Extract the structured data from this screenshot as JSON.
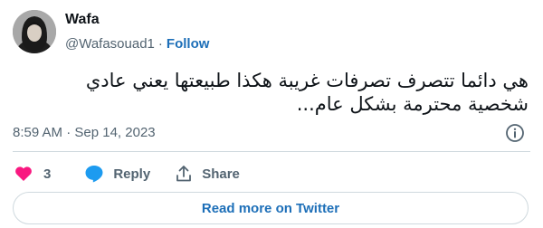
{
  "author": {
    "name": "Wafa",
    "handle": "@Wafasouad1",
    "separator": "·",
    "follow_label": "Follow"
  },
  "tweet": {
    "line1": "هي دائما تتصرف تصرفات غريبة هكذا طبيعتها يعني عادي",
    "line2": "شخصية محترمة بشكل عام..."
  },
  "meta": {
    "time": "8:59 AM",
    "separator": "·",
    "date": "Sep 14, 2023"
  },
  "actions": {
    "like_count": "3",
    "reply_label": "Reply",
    "share_label": "Share"
  },
  "read_more_label": "Read more on Twitter",
  "colors": {
    "like": "#f91880",
    "reply": "#1d9bf0",
    "link": "#1d6fb8",
    "muted": "#536471"
  },
  "icons": [
    "avatar",
    "info-icon",
    "heart-icon",
    "reply-bubble-icon",
    "share-icon"
  ]
}
